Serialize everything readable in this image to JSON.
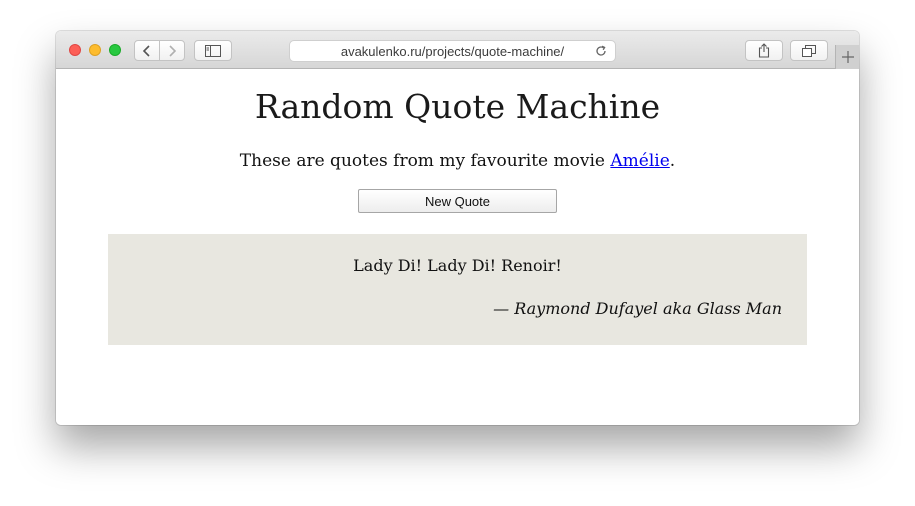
{
  "browser": {
    "address": "avakulenko.ru/projects/quote-machine/",
    "icons": {
      "back": "chevron-left-icon",
      "forward": "chevron-right-icon",
      "sidebar": "sidebar-icon",
      "reload": "reload-icon",
      "share": "share-icon",
      "tabs": "tabs-overview-icon",
      "new_tab": "plus-icon"
    }
  },
  "page": {
    "title": "Random Quote Machine",
    "subtitle_prefix": "These are quotes from my favourite movie ",
    "subtitle_link": "Amélie",
    "subtitle_suffix": ".",
    "button_label": "New Quote",
    "quote": {
      "text": "Lady Di! Lady Di! Renoir!",
      "author": "— Raymond Dufayel aka Glass Man"
    }
  },
  "colors": {
    "quote_background": "#e8e7e0",
    "link": "#0000ee"
  }
}
